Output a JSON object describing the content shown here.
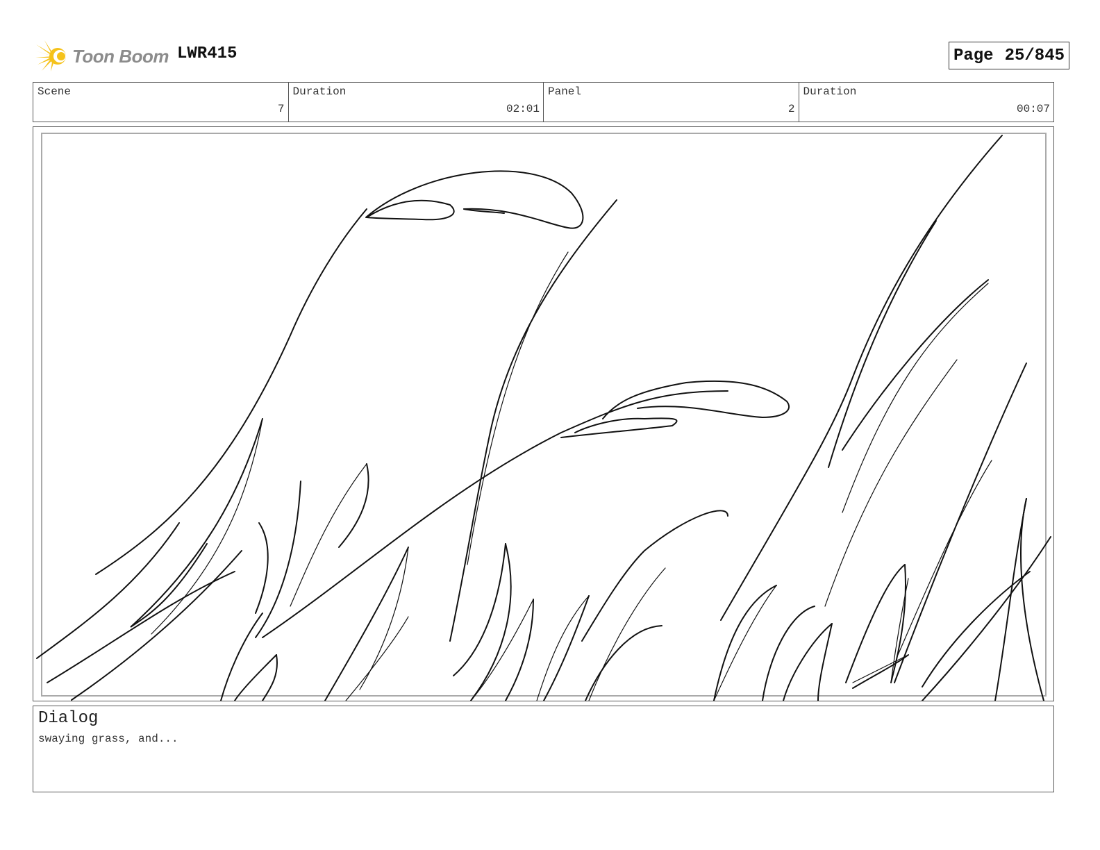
{
  "header": {
    "logo_text": "Toon Boom",
    "project_code": "LWR415",
    "page_label": "Page",
    "page_value": "25/845"
  },
  "info": {
    "scene_label": "Scene",
    "scene_value": "7",
    "scene_duration_label": "Duration",
    "scene_duration_value": "02:01",
    "panel_label": "Panel",
    "panel_value": "2",
    "panel_duration_label": "Duration",
    "panel_duration_value": "00:07"
  },
  "dialog": {
    "title": "Dialog",
    "text": "swaying grass, and..."
  },
  "colors": {
    "logo_yellow": "#f5c21a",
    "logo_gray": "#8c8c8c",
    "sketch_line": "#111111"
  },
  "icons": {
    "logo": "toon-boom-starburst-icon"
  }
}
